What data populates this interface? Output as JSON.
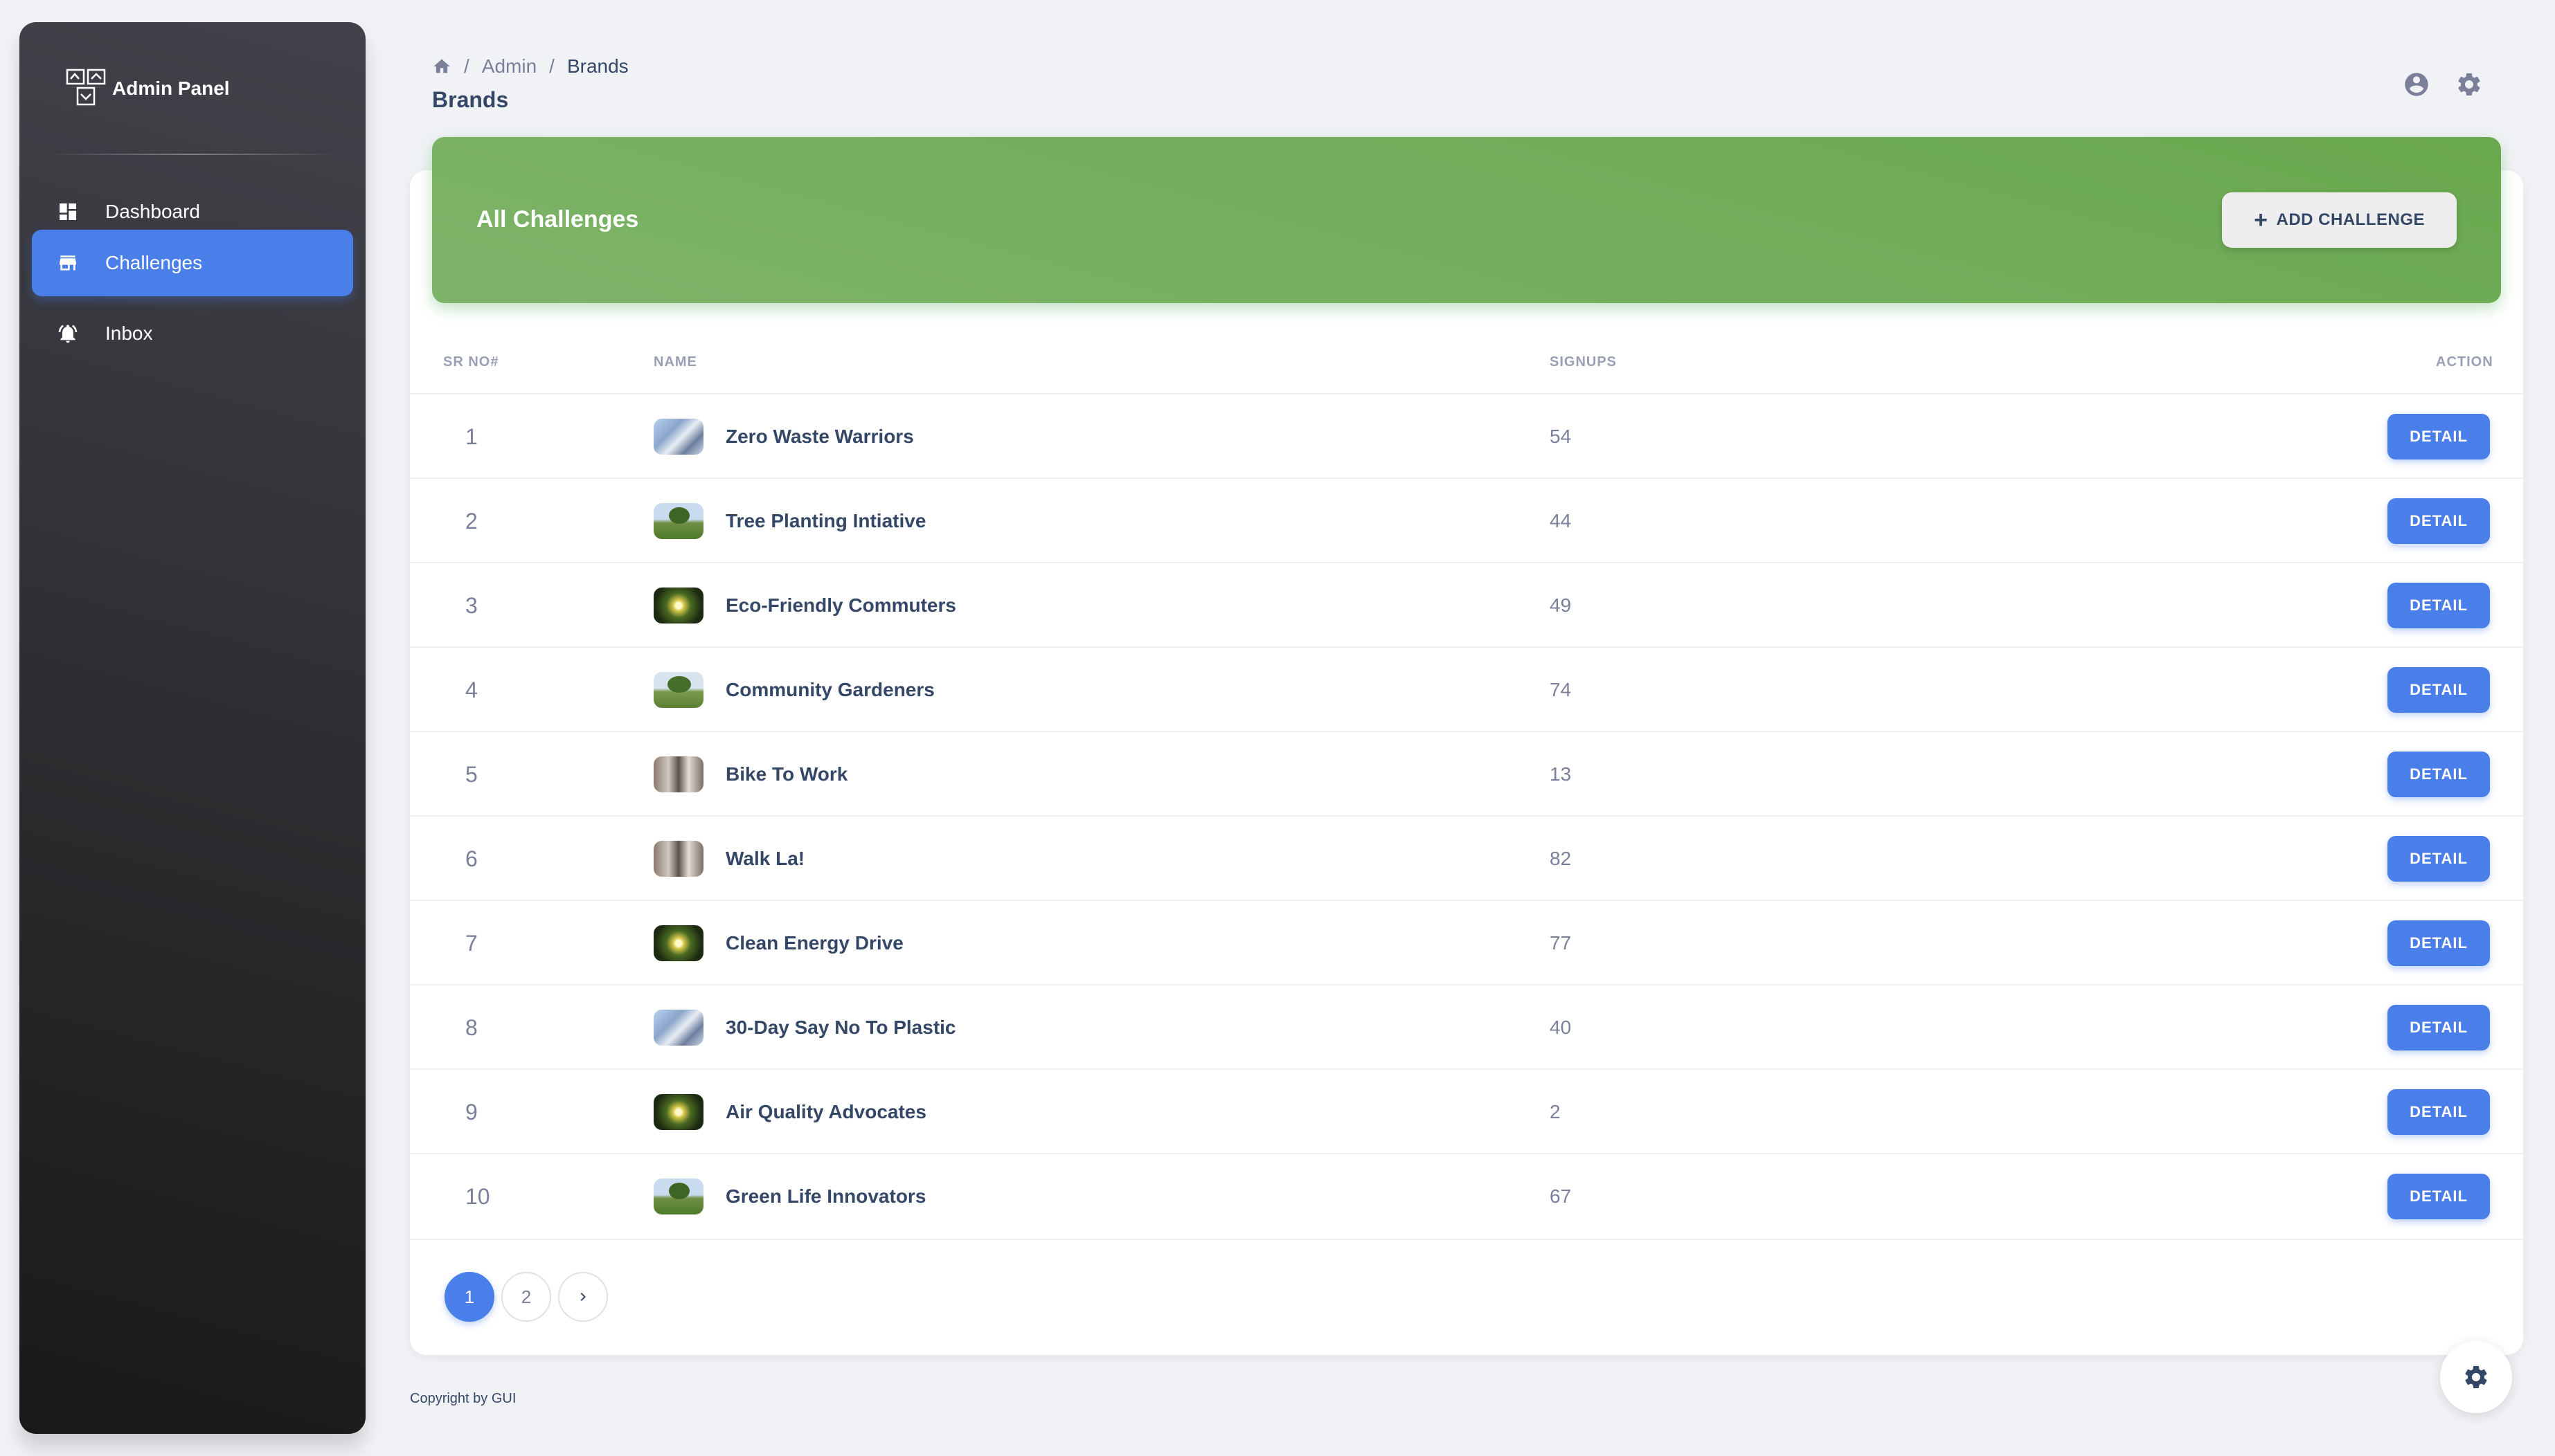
{
  "sidebar": {
    "brand": "Admin Panel",
    "items": [
      {
        "label": "Dashboard",
        "icon": "dashboard-icon",
        "active": false
      },
      {
        "label": "Challenges",
        "icon": "store-icon",
        "active": true
      },
      {
        "label": "Inbox",
        "icon": "bell-icon",
        "active": false
      }
    ]
  },
  "header": {
    "breadcrumb": [
      "Admin",
      "Brands"
    ],
    "title": "Brands"
  },
  "card": {
    "title": "All Challenges",
    "add_button": "ADD CHALLENGE"
  },
  "table": {
    "columns": [
      "SR NO#",
      "NAME",
      "SIGNUPS",
      "ACTION"
    ],
    "detail_label": "DETAIL",
    "rows": [
      {
        "no": "1",
        "name": "Zero Waste Warriors",
        "signups": "54",
        "thumb": "t1"
      },
      {
        "no": "2",
        "name": "Tree Planting Intiative",
        "signups": "44",
        "thumb": "t2"
      },
      {
        "no": "3",
        "name": "Eco-Friendly Commuters",
        "signups": "49",
        "thumb": "t3"
      },
      {
        "no": "4",
        "name": "Community Gardeners",
        "signups": "74",
        "thumb": "t4"
      },
      {
        "no": "5",
        "name": "Bike To Work",
        "signups": "13",
        "thumb": "t5"
      },
      {
        "no": "6",
        "name": "Walk La!",
        "signups": "82",
        "thumb": "t5"
      },
      {
        "no": "7",
        "name": "Clean Energy Drive",
        "signups": "77",
        "thumb": "t3"
      },
      {
        "no": "8",
        "name": "30-Day Say No To Plastic",
        "signups": "40",
        "thumb": "t1"
      },
      {
        "no": "9",
        "name": "Air Quality Advocates",
        "signups": "2",
        "thumb": "t3"
      },
      {
        "no": "10",
        "name": "Green Life Innovators",
        "signups": "67",
        "thumb": "t2"
      }
    ]
  },
  "pagination": {
    "pages": [
      "1",
      "2"
    ],
    "current": "1"
  },
  "footer": "Copyright by GUI",
  "colors": {
    "accent": "#4a7ee8",
    "header_green": "#6aa84f",
    "sidebar_dark": "#191919"
  }
}
